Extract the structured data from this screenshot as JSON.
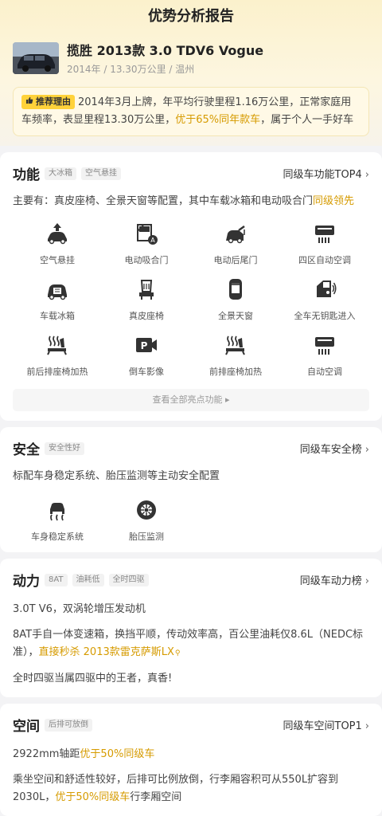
{
  "header": {
    "title": "优势分析报告"
  },
  "car": {
    "name": "揽胜 2013款 3.0 TDV6 Vogue",
    "meta": "2014年 / 13.30万公里 / 温州"
  },
  "reason": {
    "tag": "推荐理由",
    "text_1": "2014年3月上牌，年平均行驶里程1.16万公里，正常家庭用车频率，表显里程13.30万公里，",
    "highlight": "优于65%同年款车",
    "text_2": "，属于个人一手好车"
  },
  "features": {
    "title": "功能",
    "chips": [
      "大冰箱",
      "空气悬挂"
    ],
    "rank": "同级车功能TOP4",
    "summary_1": "主要有：真皮座椅、全景天窗等配置，其中车载冰箱和电动吸合门",
    "summary_hl": "同级领先",
    "items": [
      {
        "label": "空气悬挂",
        "icon": "air-suspension-icon"
      },
      {
        "label": "电动吸合门",
        "icon": "soft-close-door-icon"
      },
      {
        "label": "电动后尾门",
        "icon": "power-tailgate-icon"
      },
      {
        "label": "四区自动空调",
        "icon": "four-zone-ac-icon"
      },
      {
        "label": "车载冰箱",
        "icon": "fridge-icon"
      },
      {
        "label": "真皮座椅",
        "icon": "leather-seat-icon"
      },
      {
        "label": "全景天窗",
        "icon": "panoramic-sunroof-icon"
      },
      {
        "label": "全车无钥匙进入",
        "icon": "keyless-entry-icon"
      },
      {
        "label": "前后排座椅加热",
        "icon": "front-rear-seat-heating-icon"
      },
      {
        "label": "倒车影像",
        "icon": "reverse-camera-icon"
      },
      {
        "label": "前排座椅加热",
        "icon": "front-seat-heating-icon"
      },
      {
        "label": "自动空调",
        "icon": "auto-ac-icon"
      }
    ],
    "view_all": "查看全部亮点功能 ▸"
  },
  "safety": {
    "title": "安全",
    "chips": [
      "安全性好"
    ],
    "rank": "同级车安全榜",
    "summary": "标配车身稳定系统、胎压监测等主动安全配置",
    "items": [
      {
        "label": "车身稳定系统",
        "icon": "stability-control-icon"
      },
      {
        "label": "胎压监测",
        "icon": "tire-pressure-icon"
      }
    ]
  },
  "power": {
    "title": "动力",
    "chips": [
      "8AT",
      "油耗低",
      "全时四驱"
    ],
    "rank": "同级车动力榜",
    "p1": "3.0T V6，双涡轮增压发动机",
    "p2_a": "8AT手自一体变速箱，换挡平顺，传动效率高，百公里油耗仅8.6L（NEDC标准），",
    "p2_hl": "直接秒杀 2013款雷克萨斯LX",
    "p3": "全时四驱当属四驱中的王者，真香!"
  },
  "space": {
    "title": "空间",
    "chips": [
      "后排可放倒"
    ],
    "rank": "同级车空间TOP1",
    "p1_a": "2922mm轴距",
    "p1_hl": "优于50%同级车",
    "p2_a": "乘坐空间和舒适性较好，后排可比例放倒，行李厢容积可从550L扩容到2030L，",
    "p2_hl": "优于50%同级车",
    "p2_b": "行李厢空间"
  },
  "colors": {
    "accent": "#d69b00",
    "tag": "#ffd23a"
  }
}
